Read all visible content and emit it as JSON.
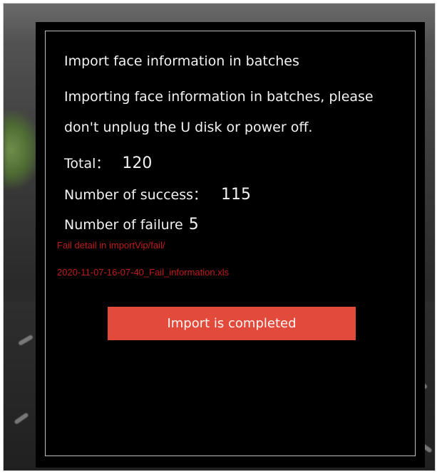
{
  "dialog": {
    "title": "Import face information in batches",
    "message_line1": "Importing face information in batches, please",
    "message_line2": "don't unplug the U disk or power off.",
    "total_label": "Total：",
    "total_value": "120",
    "success_label": "Number of success：",
    "success_value": "115",
    "failure_label": "Number of failure",
    "failure_value": "5",
    "fail_detail_line1": "Fail detail in importVip/fail/",
    "fail_detail_line2": "2020-11-07-16-07-40_Fail_information.xls",
    "complete_button": "Import is completed"
  },
  "colors": {
    "dialog_bg": "#000000",
    "text": "#f2f2f2",
    "fail_text": "#d41f1f",
    "button_bg": "#e24a3c"
  }
}
